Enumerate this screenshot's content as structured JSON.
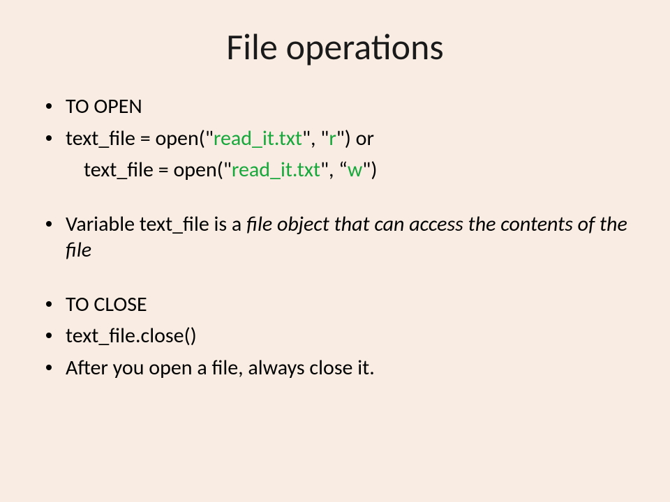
{
  "title": "File operations",
  "bullets": {
    "b1": "TO OPEN",
    "b2_pre": "text_file = open(\"",
    "b2_file": "read_it.txt",
    "b2_mid": "\", \"",
    "b2_mode": "r",
    "b2_post": "\") or",
    "b3_pre": "text_file = open(\"",
    "b3_file": "read_it.txt",
    "b3_mid": "\", “",
    "b3_mode": "w",
    "b3_post": "\")",
    "b4_pre": "Variable text_file is a ",
    "b4_italic": "file object that can access the contents of the file",
    "b5": "TO CLOSE",
    "b6": "text_file.close()",
    "b7": "After you open a file, always close it."
  }
}
